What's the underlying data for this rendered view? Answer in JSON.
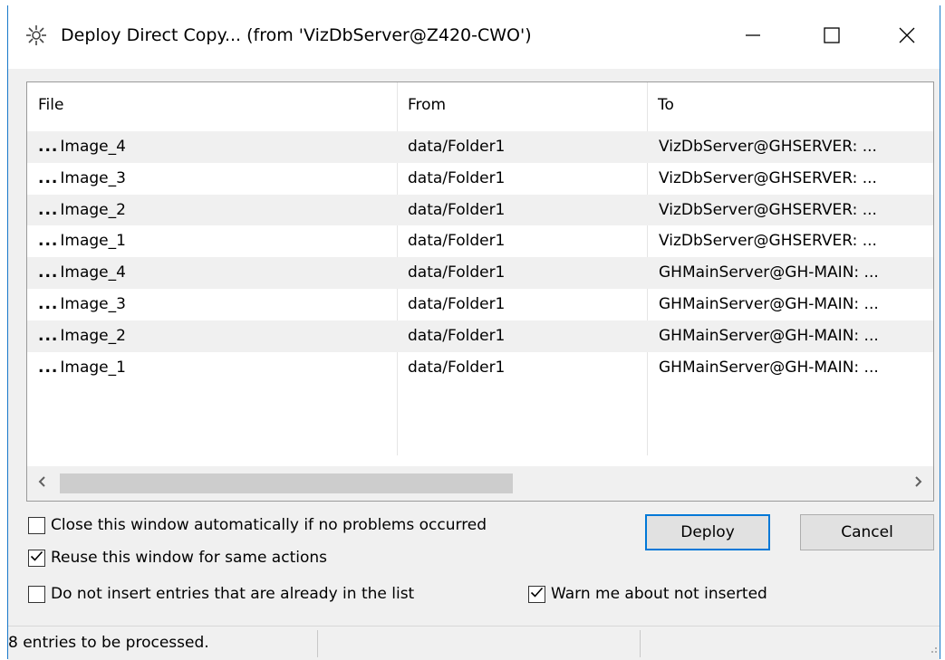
{
  "window": {
    "title": "Deploy Direct Copy... (from 'VizDbServer@Z420-CWO')"
  },
  "columns": {
    "file": "File",
    "from": "From",
    "to": "To"
  },
  "rows": [
    {
      "file": "Image_4",
      "from": "data/Folder1",
      "to": "VizDbServer@GHSERVER: ..."
    },
    {
      "file": "Image_3",
      "from": "data/Folder1",
      "to": "VizDbServer@GHSERVER: ..."
    },
    {
      "file": "Image_2",
      "from": "data/Folder1",
      "to": "VizDbServer@GHSERVER: ..."
    },
    {
      "file": "Image_1",
      "from": "data/Folder1",
      "to": "VizDbServer@GHSERVER: ..."
    },
    {
      "file": "Image_4",
      "from": "data/Folder1",
      "to": "GHMainServer@GH-MAIN: ..."
    },
    {
      "file": "Image_3",
      "from": "data/Folder1",
      "to": "GHMainServer@GH-MAIN: ..."
    },
    {
      "file": "Image_2",
      "from": "data/Folder1",
      "to": "GHMainServer@GH-MAIN: ..."
    },
    {
      "file": "Image_1",
      "from": "data/Folder1",
      "to": "GHMainServer@GH-MAIN: ..."
    }
  ],
  "row_prefix": "...",
  "options": {
    "close_auto": {
      "label": "Close this window automatically if no problems occurred",
      "checked": false
    },
    "reuse": {
      "label": "Reuse this window for same actions",
      "checked": true
    },
    "no_insert": {
      "label": "Do not insert entries that are already in the list",
      "checked": false
    },
    "warn": {
      "label": "Warn me about not inserted",
      "checked": true
    }
  },
  "buttons": {
    "deploy": "Deploy",
    "cancel": "Cancel"
  },
  "status": {
    "text": "8 entries to be processed."
  },
  "icons": {
    "app": "gear-cluster-icon",
    "minimize": "minimize-icon",
    "maximize": "maximize-icon",
    "close": "close-icon",
    "scroll_left": "chevron-left-icon",
    "scroll_right": "chevron-right-icon",
    "check": "checkmark-icon",
    "grip": "resize-grip-icon"
  },
  "colors": {
    "accent": "#0078d7",
    "window_border": "#1979ca"
  }
}
